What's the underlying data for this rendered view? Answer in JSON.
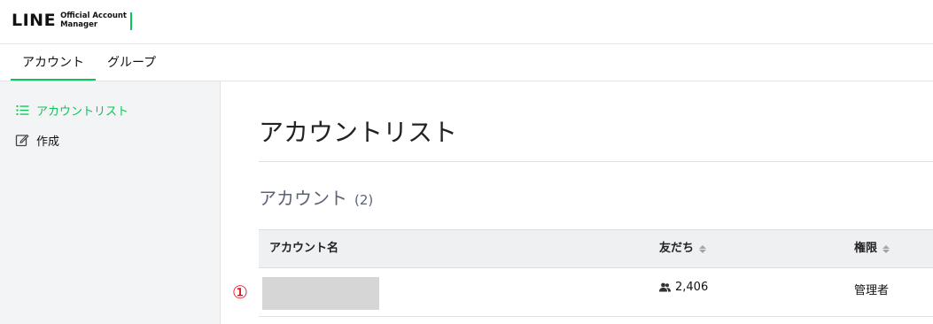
{
  "logo": {
    "brand": "LINE",
    "sub_line1": "Official Account",
    "sub_line2": "Manager"
  },
  "tabs": [
    {
      "label": "アカウント",
      "active": true
    },
    {
      "label": "グループ",
      "active": false
    }
  ],
  "sidebar": {
    "items": [
      {
        "label": "アカウントリスト",
        "icon": "list-icon",
        "active": true
      },
      {
        "label": "作成",
        "icon": "edit-icon",
        "active": false
      }
    ]
  },
  "main": {
    "title": "アカウントリスト",
    "section_title": "アカウント",
    "section_count": "(2)"
  },
  "table": {
    "columns": [
      "アカウント名",
      "友だち",
      "権限"
    ],
    "rows": [
      {
        "marker": "①",
        "name": "",
        "friends": "2,406",
        "role": "管理者"
      }
    ]
  },
  "colors": {
    "accent": "#06c755",
    "marker": "#e60012",
    "section_text": "#5b6378"
  }
}
